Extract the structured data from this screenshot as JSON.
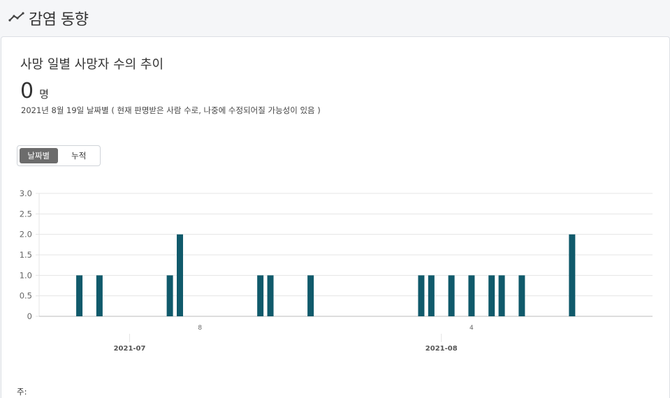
{
  "header": {
    "title": "감염 동향",
    "icon": "trend-line-icon"
  },
  "card": {
    "title": "사망 일별 사망자 수의 추이",
    "count_value": "0",
    "count_unit": "명",
    "note": "2021년 8월 19일 날짜별 ( 현재 판명받은 사람 수로, 나중에 수정되어질 가능성이 있음 )",
    "toggle": {
      "daily_label": "날짜별",
      "cumulative_label": "누적",
      "selected": "daily"
    },
    "footnote": "주:"
  },
  "colors": {
    "bar": "#105a6b",
    "grid": "#e4e4e4",
    "toggle_active": "#6c6c6c"
  },
  "chart_data": {
    "type": "bar",
    "ylim": [
      0,
      3
    ],
    "yticks": [
      "0",
      "0.5",
      "1.0",
      "1.5",
      "2.0",
      "2.5",
      "3.0"
    ],
    "xlim": [
      "2021-06-22",
      "2021-08-22"
    ],
    "day_tick_labels": [
      {
        "date": "2021-07-08",
        "label": "8"
      },
      {
        "date": "2021-08-04",
        "label": "4"
      }
    ],
    "month_tick_labels": [
      {
        "date": "2021-07-01",
        "label": "2021-07"
      },
      {
        "date": "2021-08-01",
        "label": "2021-08"
      }
    ],
    "series": [
      {
        "x": [
          "2021-06-26",
          "2021-06-28",
          "2021-07-05",
          "2021-07-06",
          "2021-07-14",
          "2021-07-15",
          "2021-07-19",
          "2021-07-30",
          "2021-07-31",
          "2021-08-02",
          "2021-08-04",
          "2021-08-06",
          "2021-08-07",
          "2021-08-09",
          "2021-08-14"
        ],
        "values": [
          1,
          1,
          1,
          2,
          1,
          1,
          1,
          1,
          1,
          1,
          1,
          1,
          1,
          1,
          2
        ]
      }
    ]
  }
}
